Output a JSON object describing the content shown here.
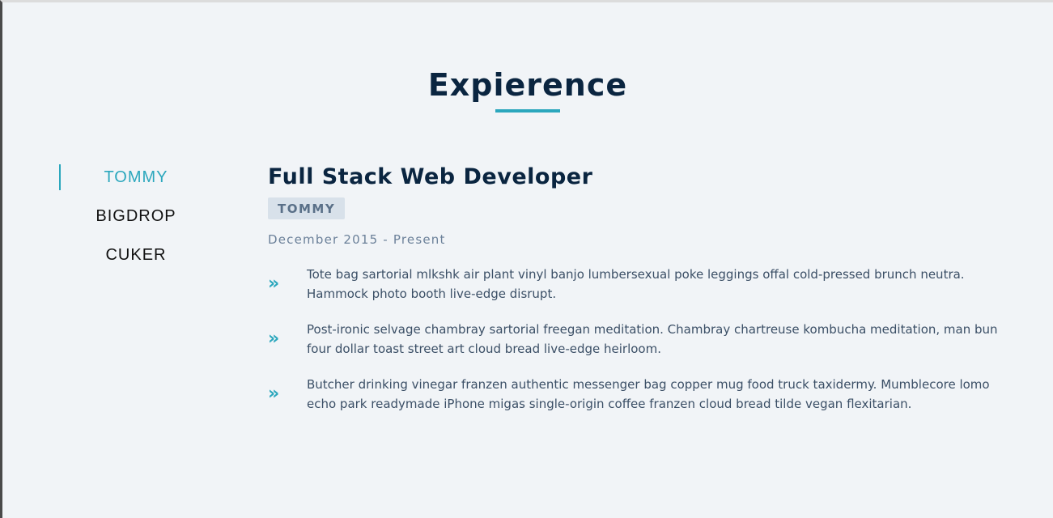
{
  "section": {
    "title": "Expierence"
  },
  "tabs": [
    {
      "label": "TOMMY",
      "active": true
    },
    {
      "label": "BIGDROP",
      "active": false
    },
    {
      "label": "CUKER",
      "active": false
    }
  ],
  "job": {
    "title": "Full Stack Web Developer",
    "company": "TOMMY",
    "dates": "December 2015 - Present",
    "duties": [
      {
        "icon": "double-chevron-right-icon",
        "text": "Tote bag sartorial mlkshk air plant vinyl banjo lumbersexual poke leggings offal cold-pressed brunch neutra. Hammock photo booth live-edge disrupt."
      },
      {
        "icon": "double-chevron-right-icon",
        "text": "Post-ironic selvage chambray sartorial freegan meditation. Chambray chartreuse kombucha meditation, man bun four dollar toast street art cloud bread live-edge heirloom."
      },
      {
        "icon": "double-chevron-right-icon",
        "text": "Butcher drinking vinegar franzen authentic messenger bag copper mug food truck taxidermy. Mumblecore lomo echo park readymade iPhone migas single-origin coffee franzen cloud bread tilde vegan flexitarian."
      }
    ]
  },
  "colors": {
    "accent": "#2ba7bd",
    "heading": "#0a2540",
    "background": "#f1f4f7",
    "badge_bg": "#d8e1ea"
  }
}
